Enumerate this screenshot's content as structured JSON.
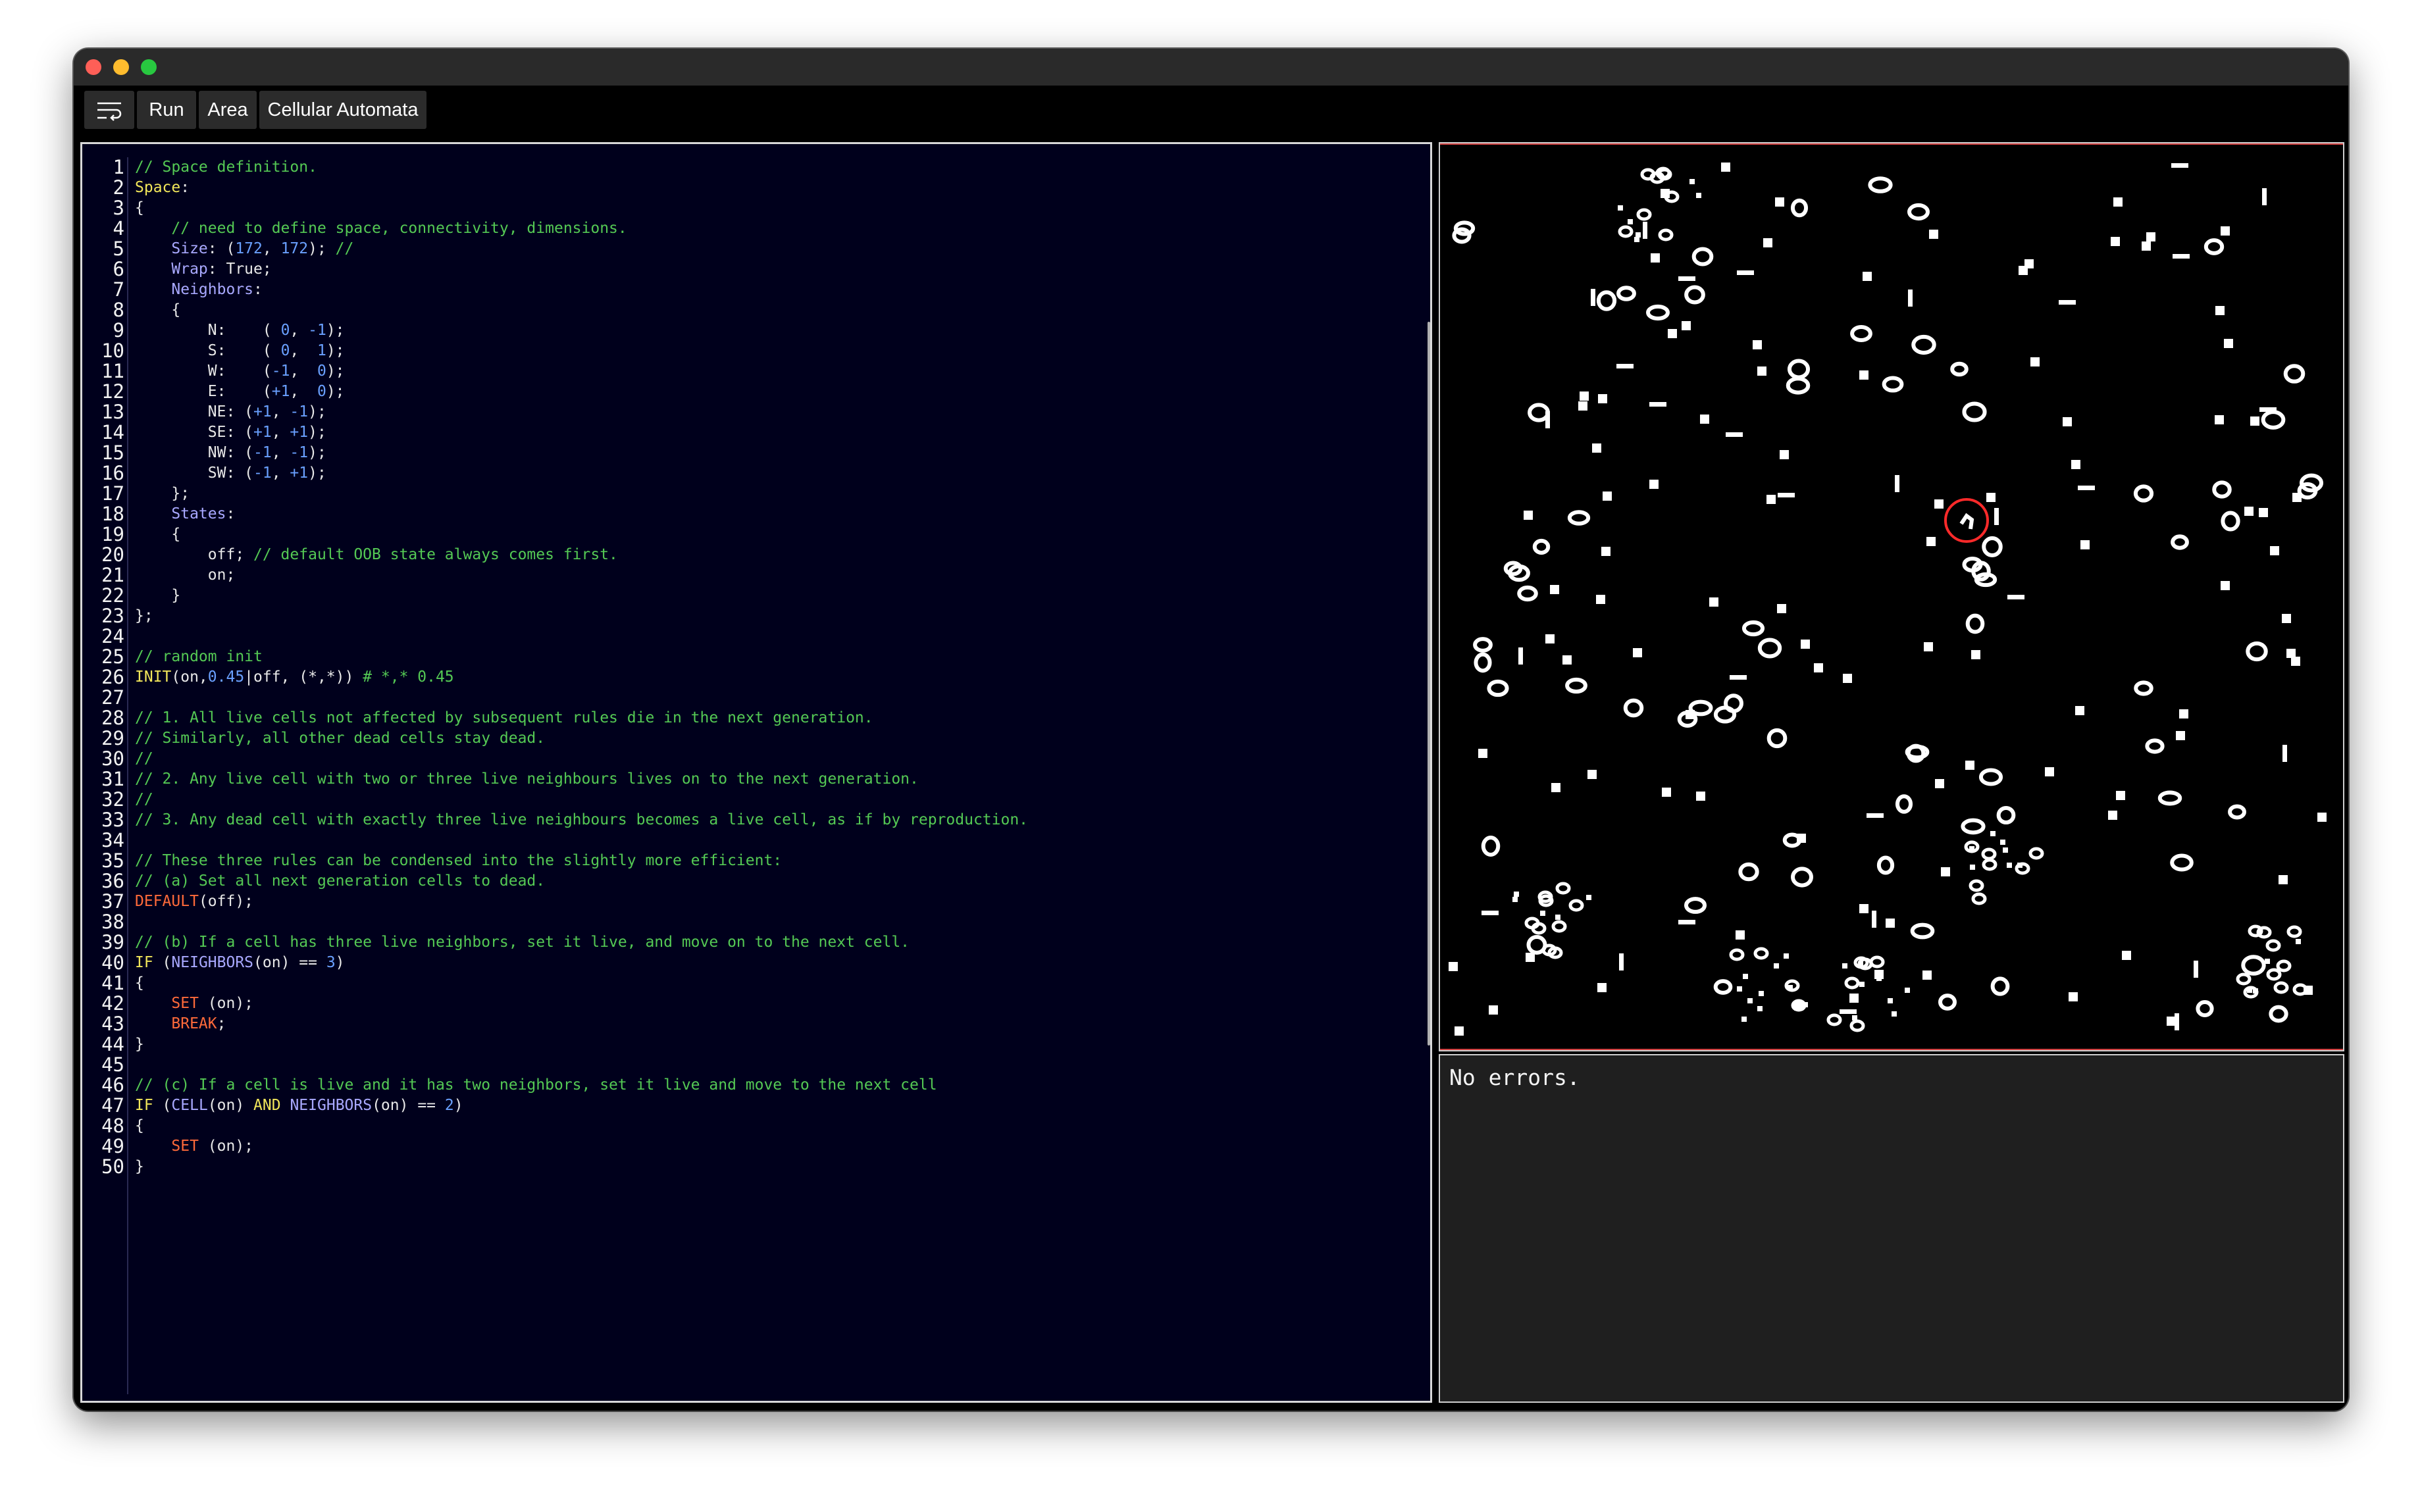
{
  "toolbar": {
    "run_label": "Run",
    "area_label": "Area",
    "ca_label": "Cellular Automata"
  },
  "editor": {
    "lines": [
      [
        [
          "c",
          "// Space definition."
        ]
      ],
      [
        [
          "k",
          "Space"
        ],
        [
          "d",
          ":"
        ]
      ],
      [
        [
          "d",
          "{"
        ]
      ],
      [
        [
          "c",
          "    // need to define space, connectivity, dimensions."
        ]
      ],
      [
        [
          "i",
          "    Size"
        ],
        [
          "d",
          ": ("
        ],
        [
          "n",
          "172"
        ],
        [
          "d",
          ", "
        ],
        [
          "n",
          "172"
        ],
        [
          "d",
          "); "
        ],
        [
          "c",
          "//"
        ]
      ],
      [
        [
          "i",
          "    Wrap"
        ],
        [
          "d",
          ": True;"
        ]
      ],
      [
        [
          "i",
          "    Neighbors"
        ],
        [
          "d",
          ":"
        ]
      ],
      [
        [
          "d",
          "    {"
        ]
      ],
      [
        [
          "d",
          "        N:    ( "
        ],
        [
          "n",
          "0"
        ],
        [
          "d",
          ", "
        ],
        [
          "n",
          "-1"
        ],
        [
          "d",
          ");"
        ]
      ],
      [
        [
          "d",
          "        S:    ( "
        ],
        [
          "n",
          "0"
        ],
        [
          "d",
          ",  "
        ],
        [
          "n",
          "1"
        ],
        [
          "d",
          ");"
        ]
      ],
      [
        [
          "d",
          "        W:    ("
        ],
        [
          "n",
          "-1"
        ],
        [
          "d",
          ",  "
        ],
        [
          "n",
          "0"
        ],
        [
          "d",
          ");"
        ]
      ],
      [
        [
          "d",
          "        E:    ("
        ],
        [
          "n",
          "+1"
        ],
        [
          "d",
          ",  "
        ],
        [
          "n",
          "0"
        ],
        [
          "d",
          ");"
        ]
      ],
      [
        [
          "d",
          "        NE: ("
        ],
        [
          "n",
          "+1"
        ],
        [
          "d",
          ", "
        ],
        [
          "n",
          "-1"
        ],
        [
          "d",
          ");"
        ]
      ],
      [
        [
          "d",
          "        SE: ("
        ],
        [
          "n",
          "+1"
        ],
        [
          "d",
          ", "
        ],
        [
          "n",
          "+1"
        ],
        [
          "d",
          ");"
        ]
      ],
      [
        [
          "d",
          "        NW: ("
        ],
        [
          "n",
          "-1"
        ],
        [
          "d",
          ", "
        ],
        [
          "n",
          "-1"
        ],
        [
          "d",
          ");"
        ]
      ],
      [
        [
          "d",
          "        SW: ("
        ],
        [
          "n",
          "-1"
        ],
        [
          "d",
          ", "
        ],
        [
          "n",
          "+1"
        ],
        [
          "d",
          ");"
        ]
      ],
      [
        [
          "d",
          "    };"
        ]
      ],
      [
        [
          "i",
          "    States"
        ],
        [
          "d",
          ":"
        ]
      ],
      [
        [
          "d",
          "    {"
        ]
      ],
      [
        [
          "d",
          "        off; "
        ],
        [
          "c",
          "// default OOB state always comes first."
        ]
      ],
      [
        [
          "d",
          "        on;"
        ]
      ],
      [
        [
          "d",
          "    }"
        ]
      ],
      [
        [
          "d",
          "};"
        ]
      ],
      [
        [
          "d",
          ""
        ]
      ],
      [
        [
          "c",
          "// random init"
        ]
      ],
      [
        [
          "k",
          "INIT"
        ],
        [
          "d",
          "(on,"
        ],
        [
          "n",
          "0.45"
        ],
        [
          "d",
          "|off, (*,*)) "
        ],
        [
          "c",
          "# *,* 0.45"
        ]
      ],
      [
        [
          "d",
          ""
        ]
      ],
      [
        [
          "c",
          "// 1. All live cells not affected by subsequent rules die in the next generation."
        ]
      ],
      [
        [
          "c",
          "// Similarly, all other dead cells stay dead."
        ]
      ],
      [
        [
          "c",
          "//"
        ]
      ],
      [
        [
          "c",
          "// 2. Any live cell with two or three live neighbours lives on to the next generation."
        ]
      ],
      [
        [
          "c",
          "//"
        ]
      ],
      [
        [
          "c",
          "// 3. Any dead cell with exactly three live neighbours becomes a live cell, as if by reproduction."
        ]
      ],
      [
        [
          "d",
          ""
        ]
      ],
      [
        [
          "c",
          "// These three rules can be condensed into the slightly more efficient:"
        ]
      ],
      [
        [
          "c",
          "// (a) Set all next generation cells to dead."
        ]
      ],
      [
        [
          "r",
          "DEFAULT"
        ],
        [
          "d",
          "(off);"
        ]
      ],
      [
        [
          "d",
          ""
        ]
      ],
      [
        [
          "c",
          "// (b) If a cell has three live neighbors, set it live, and move on to the next cell."
        ]
      ],
      [
        [
          "k",
          "IF"
        ],
        [
          "d",
          " ("
        ],
        [
          "i",
          "NEIGHBORS"
        ],
        [
          "d",
          "(on) == "
        ],
        [
          "n",
          "3"
        ],
        [
          "d",
          ")"
        ]
      ],
      [
        [
          "d",
          "{"
        ]
      ],
      [
        [
          "r",
          "    SET"
        ],
        [
          "d",
          " (on);"
        ]
      ],
      [
        [
          "r",
          "    BREAK"
        ],
        [
          "d",
          ";"
        ]
      ],
      [
        [
          "d",
          "}"
        ]
      ],
      [
        [
          "d",
          ""
        ]
      ],
      [
        [
          "c",
          "// (c) If a cell is live and it has two neighbors, set it live and move to the next cell"
        ]
      ],
      [
        [
          "k",
          "IF"
        ],
        [
          "d",
          " ("
        ],
        [
          "i",
          "CELL"
        ],
        [
          "d",
          "(on) "
        ],
        [
          "k",
          "AND"
        ],
        [
          "d",
          " "
        ],
        [
          "i",
          "NEIGHBORS"
        ],
        [
          "d",
          "(on) == "
        ],
        [
          "n",
          "2"
        ],
        [
          "d",
          ")"
        ]
      ],
      [
        [
          "d",
          "{"
        ]
      ],
      [
        [
          "r",
          "    SET"
        ],
        [
          "d",
          " (on);"
        ]
      ],
      [
        [
          "d",
          "}"
        ]
      ]
    ]
  },
  "output": {
    "message": "No errors."
  },
  "colors": {
    "editor_bg": "#00001c",
    "comment": "#54c954",
    "keyword": "#f1e65a",
    "identifier": "#a9a9ff",
    "number": "#6aa0ff",
    "red_keyword": "#ff6a3a",
    "cell_on": "#ffffff",
    "cell_off": "#000000",
    "selection_circle": "#ff2a2a"
  },
  "icons": {
    "menu": "wrap-lines-icon"
  }
}
